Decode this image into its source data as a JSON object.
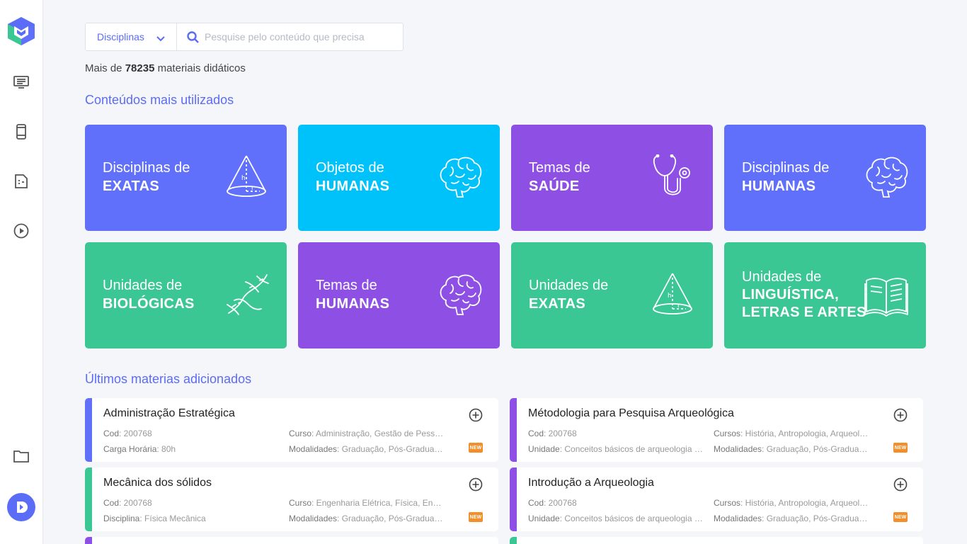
{
  "search": {
    "select_label": "Disciplinas",
    "placeholder": "Pesquise pelo conteúdo que precisa"
  },
  "summary": {
    "prefix": "Mais de",
    "count": "78235",
    "suffix": "materiais didáticos"
  },
  "sections": {
    "popular": "Conteúdos mais utilizados",
    "latest": "Últimos materias adicionados"
  },
  "colors": {
    "primary": "#5b6cf6",
    "blue": "#6170fa",
    "cyan": "#00c2fb",
    "purple": "#8e4fe5",
    "green": "#3ac793",
    "new_badge": "#f28f2a"
  },
  "cards": [
    {
      "lead": "Disciplinas de",
      "main": "EXATAS",
      "color": "#6170fa",
      "icon": "cone-icon"
    },
    {
      "lead": "Objetos de",
      "main": "HUMANAS",
      "color": "#00c2fb",
      "icon": "brain-icon"
    },
    {
      "lead": "Temas de",
      "main": "SAÚDE",
      "color": "#8e4fe5",
      "icon": "stethoscope-icon"
    },
    {
      "lead": "Disciplinas de",
      "main": "HUMANAS",
      "color": "#6170fa",
      "icon": "brain-icon"
    },
    {
      "lead": "Unidades de",
      "main": "BIOLÓGICAS",
      "color": "#3ac793",
      "icon": "dna-icon"
    },
    {
      "lead": "Temas de",
      "main": "HUMANAS",
      "color": "#8e4fe5",
      "icon": "brain-icon"
    },
    {
      "lead": "Unidades de",
      "main": "EXATAS",
      "color": "#3ac793",
      "icon": "cone-icon"
    },
    {
      "lead": "Unidades de",
      "main": "LINGUÍSTICA,",
      "main2": "LETRAS E ARTES",
      "color": "#3ac793",
      "icon": "book-icon"
    }
  ],
  "items": [
    {
      "title": "Administração Estratégica",
      "color": "#6170fa",
      "f1k": "Cod",
      "f1v": ": 200768",
      "f2k": "Curso",
      "f2v": ": Administração, Gestão de Pessoa...",
      "f3k": "Carga Horária",
      "f3v": ": 80h",
      "f4k": "Modalidades",
      "f4v": ": Graduação, Pós-Graduaçã...",
      "badge": "NEW"
    },
    {
      "title": "Métodologia para Pesquisa Arqueológica",
      "color": "#8e4fe5",
      "f1k": "Cod",
      "f1v": ": 200768",
      "f2k": "Cursos",
      "f2v": ": História, Antropologia, Arqueolo...",
      "f3k": "Unidade",
      "f3v": ": Conceitos básicos de arqueologia e...",
      "f4k": "Modalidades",
      "f4v": ": Graduação, Pós-Graduaçã...",
      "badge": "NEW"
    },
    {
      "title": "Mecânica dos sólidos",
      "color": "#3ac793",
      "f1k": "Cod",
      "f1v": ": 200768",
      "f2k": "Curso",
      "f2v": ": Engenharia Elétrica, Física, Engen...",
      "f3k": "Disciplina",
      "f3v": ": Física Mecânica",
      "f4k": "Modalidades",
      "f4v": ": Graduação, Pós-Graduaçã...",
      "badge": "NEW"
    },
    {
      "title": "Introdução a Arqueologia",
      "color": "#8e4fe5",
      "f1k": "Cod",
      "f1v": ": 200768",
      "f2k": "Cursos",
      "f2v": ": História, Antropologia, Arqueolo...",
      "f3k": "Unidade",
      "f3v": ": Conceitos básicos de arqueologia e...",
      "f4k": "Modalidades",
      "f4v": ": Graduação, Pós-Graduaçã...",
      "badge": "NEW"
    }
  ]
}
